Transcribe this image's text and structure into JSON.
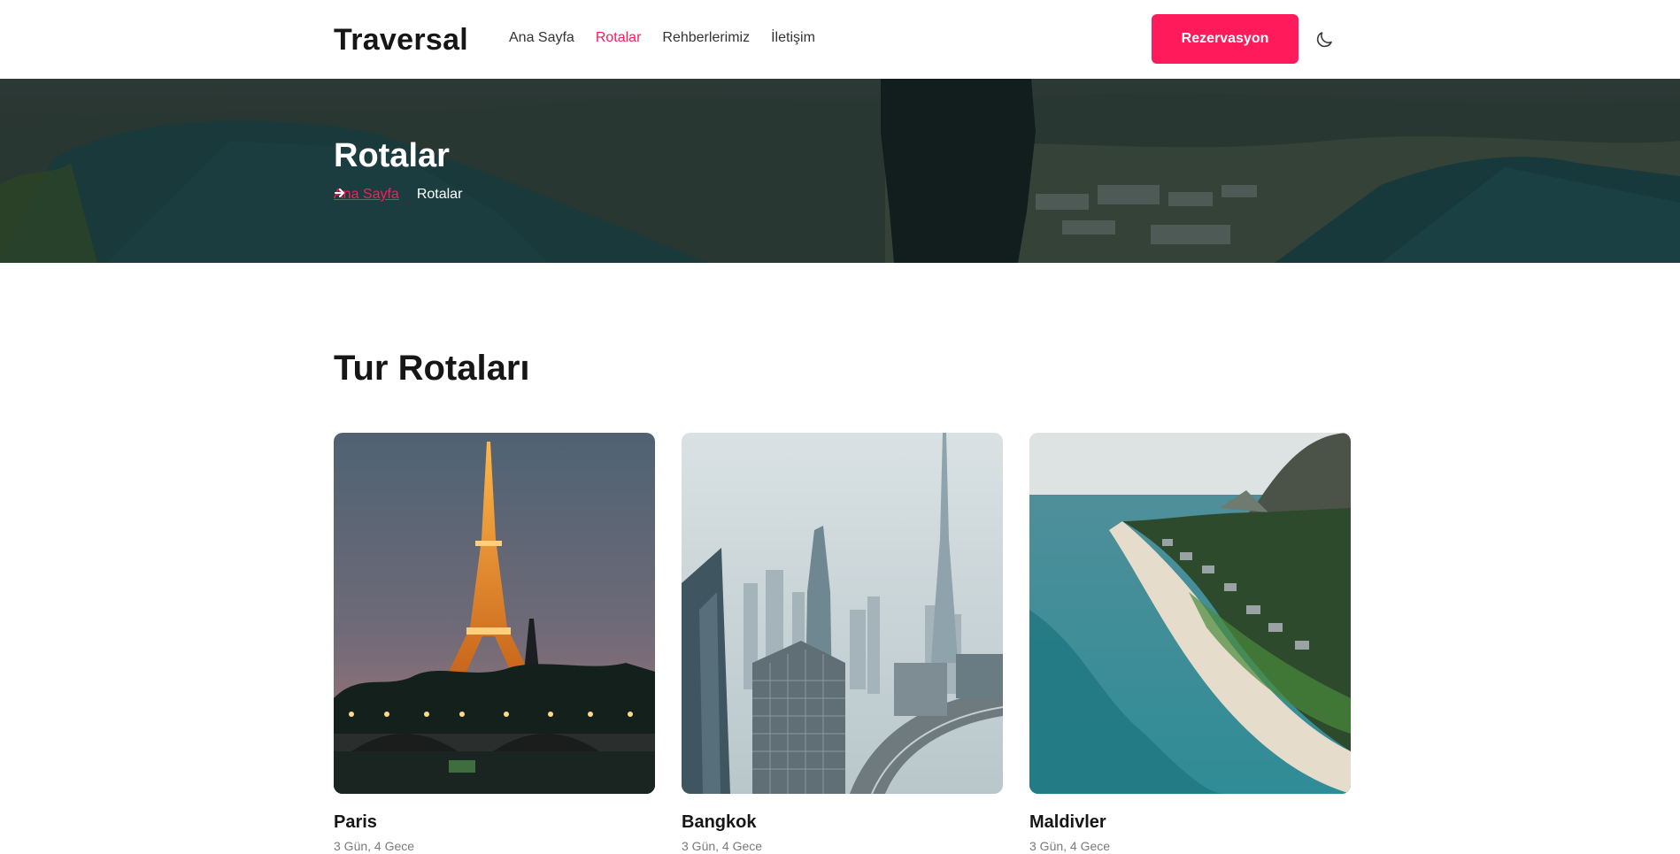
{
  "header": {
    "brand": "Traversal",
    "nav": [
      {
        "label": "Ana Sayfa",
        "active": false
      },
      {
        "label": "Rotalar",
        "active": true
      },
      {
        "label": "Rehberlerimiz",
        "active": false
      },
      {
        "label": "İletişim",
        "active": false
      }
    ],
    "cta_label": "Rezervasyon",
    "theme_toggle_icon": "moon-icon"
  },
  "hero": {
    "title": "Rotalar",
    "breadcrumb": {
      "home": "Ana Sayfa",
      "separator_icon": "arrow-right-icon",
      "current": "Rotalar"
    }
  },
  "section": {
    "title": "Tur Rotaları",
    "routes": [
      {
        "name": "Paris",
        "duration": "3 Gün, 4 Gece"
      },
      {
        "name": "Bangkok",
        "duration": "3 Gün, 4 Gece"
      },
      {
        "name": "Maldivler",
        "duration": "3 Gün, 4 Gece"
      }
    ]
  },
  "colors": {
    "accent": "#ff1a5c",
    "text": "#161616",
    "muted": "#7a7a7a"
  }
}
